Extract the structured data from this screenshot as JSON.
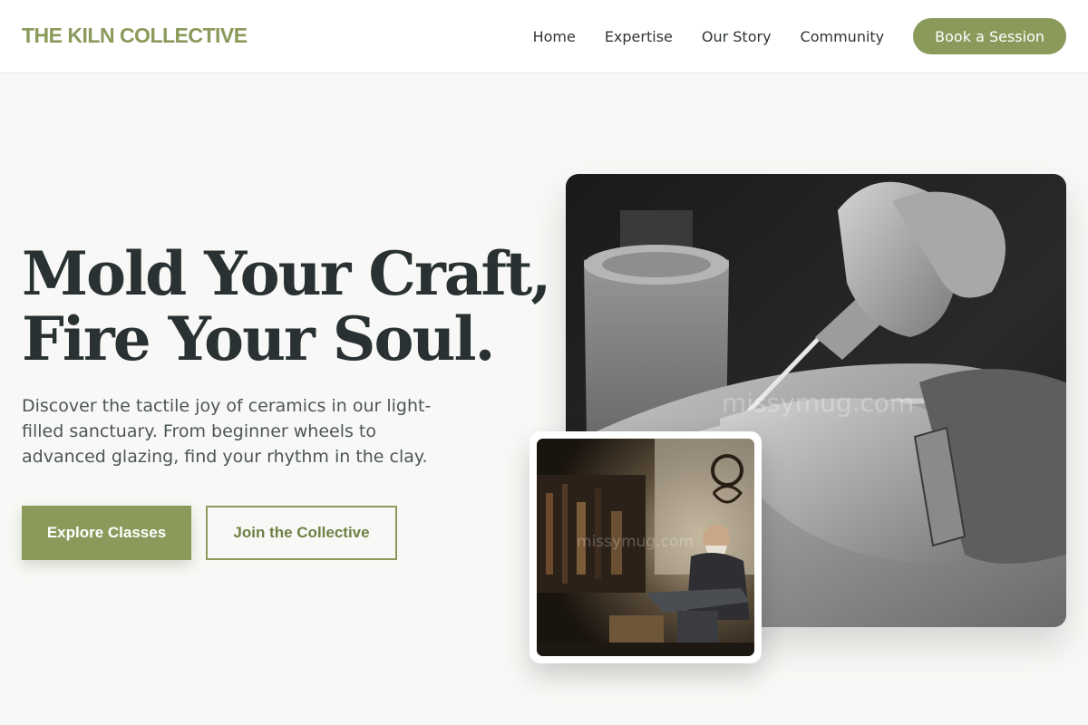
{
  "header": {
    "brand": "THE KILN COLLECTIVE",
    "nav": [
      "Home",
      "Expertise",
      "Our Story",
      "Community"
    ],
    "cta_label": "Book a Session"
  },
  "hero": {
    "title_line1": "Mold Your Craft,",
    "title_line2": "Fire Your Soul.",
    "subtitle": "Discover the tactile joy of ceramics in our light-filled sanctuary. From beginner wheels to advanced glazing, find your rhythm in the clay.",
    "primary_button": "Explore Classes",
    "secondary_button": "Join the Collective"
  },
  "images": {
    "main_watermark": "missymug.com",
    "inset_watermark": "missymug.com"
  },
  "colors": {
    "accent": "#8a9a5b",
    "text": "#2a3133",
    "background": "#f8f9f6"
  }
}
